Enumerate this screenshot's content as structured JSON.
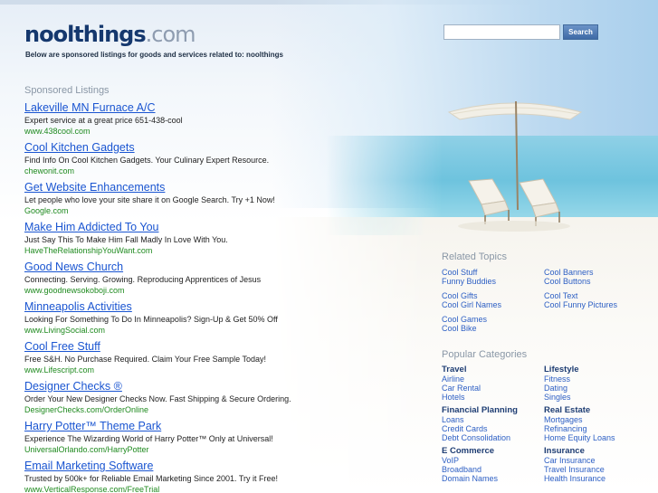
{
  "header": {
    "logo_name": "noolthings",
    "logo_tld": ".com",
    "tagline": "Below are sponsored listings for goods and services related to: noolthings"
  },
  "search": {
    "value": "",
    "button_label": "Search"
  },
  "sponsored": {
    "heading": "Sponsored Listings",
    "items": [
      {
        "title": "Lakeville MN Furnace A/C",
        "desc": "Expert service at a great price 651-438-cool",
        "url": "www.438cool.com"
      },
      {
        "title": "Cool Kitchen Gadgets",
        "desc": "Find Info On Cool Kitchen Gadgets. Your Culinary Expert Resource.",
        "url": "chewonit.com"
      },
      {
        "title": "Get Website Enhancements",
        "desc": "Let people who love your site share it on Google Search. Try +1 Now!",
        "url": "Google.com"
      },
      {
        "title": "Make Him Addicted To You",
        "desc": "Just Say This To Make Him Fall Madly In Love With You.",
        "url": "HaveTheRelationshipYouWant.com"
      },
      {
        "title": "Good News Church",
        "desc": "Connecting. Serving. Growing. Reproducing Apprentices of Jesus",
        "url": "www.goodnewsokoboji.com"
      },
      {
        "title": "Minneapolis Activities",
        "desc": "Looking For Something To Do In Minneapolis? Sign-Up & Get 50% Off",
        "url": "www.LivingSocial.com"
      },
      {
        "title": "Cool Free Stuff",
        "desc": "Free S&H. No Purchase Required. Claim Your Free Sample Today!",
        "url": "www.Lifescript.com"
      },
      {
        "title": "Designer Checks ®",
        "desc": "Order Your New Designer Checks Now. Fast Shipping & Secure Ordering.",
        "url": "DesignerChecks.com/OrderOnline"
      },
      {
        "title": "Harry Potter™ Theme Park",
        "desc": "Experience The Wizarding World of Harry Potter™ Only at Universal!",
        "url": "UniversalOrlando.com/HarryPotter"
      },
      {
        "title": "Email Marketing Software",
        "desc": "Trusted by 500k+ for Reliable Email Marketing Since 2001. Try it Free!",
        "url": "www.VerticalResponse.com/FreeTrial"
      }
    ]
  },
  "related": {
    "heading": "Related Topics",
    "col_a": [
      "Cool Stuff",
      "Funny Buddies",
      "Cool Gifts",
      "Cool Girl Names",
      "Cool Games",
      "Cool Bike"
    ],
    "col_b": [
      "Cool Banners",
      "Cool Buttons",
      "Cool Text",
      "Cool Funny Pictures"
    ]
  },
  "categories": {
    "heading": "Popular Categories",
    "groups": [
      {
        "title": "Travel",
        "links": [
          "Airline",
          "Car Rental",
          "Hotels"
        ]
      },
      {
        "title": "Lifestyle",
        "links": [
          "Fitness",
          "Dating",
          "Singles"
        ]
      },
      {
        "title": "Financial Planning",
        "links": [
          "Loans",
          "Credit Cards",
          "Debt Consolidation"
        ]
      },
      {
        "title": "Real Estate",
        "links": [
          "Mortgages",
          "Refinancing",
          "Home Equity Loans"
        ]
      },
      {
        "title": "E Commerce",
        "links": [
          "VoIP",
          "Broadband",
          "Domain Names"
        ]
      },
      {
        "title": "Insurance",
        "links": [
          "Car Insurance",
          "Travel Insurance",
          "Health Insurance"
        ]
      }
    ]
  }
}
